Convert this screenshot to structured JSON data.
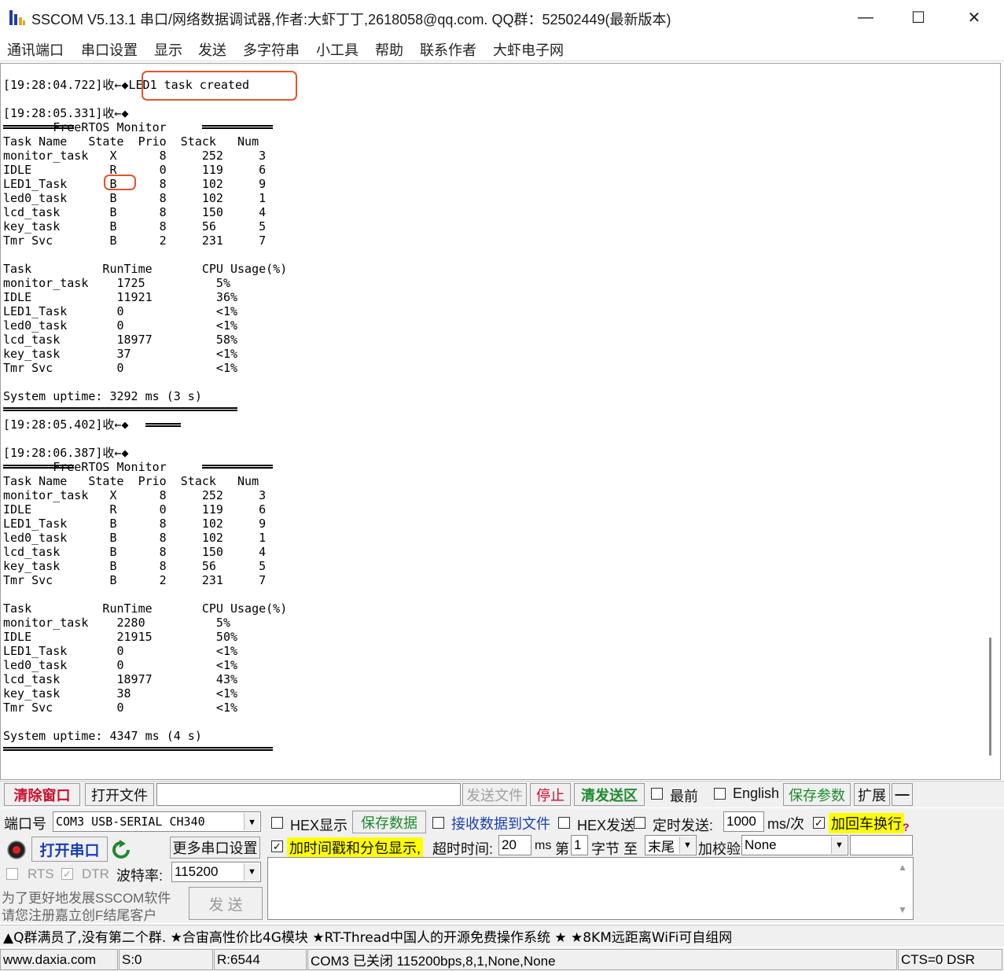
{
  "window": {
    "title": "SSCOM V5.13.1 串口/网络数据调试器,作者:大虾丁丁,2618058@qq.com. QQ群：52502449(最新版本)",
    "minimize": "—",
    "maximize": "☐",
    "close": "✕"
  },
  "menu": [
    "通讯端口",
    "串口设置",
    "显示",
    "发送",
    "多字符串",
    "小工具",
    "帮助",
    "联系作者",
    "大虾电子网"
  ],
  "receive": {
    "lines": [
      "[19:28:04.722]收←◆LED1 task created",
      "[19:28:05.331]收←◆",
      "       FreeRTOS Monitor",
      "Task Name   State  Prio  Stack   Num",
      "monitor_task   X      8     252     3",
      "IDLE           R      0     119     6",
      "LED1_Task      B      8     102     9",
      "led0_task      B      8     102     1",
      "lcd_task       B      8     150     4",
      "key_task       B      8     56      5",
      "Tmr Svc        B      2     231     7",
      "",
      "Task          RunTime       CPU Usage(%)",
      "monitor_task    1725          5%",
      "IDLE            11921         36%",
      "LED1_Task       0             <1%",
      "led0_task       0             <1%",
      "lcd_task        18977         58%",
      "key_task        37            <1%",
      "Tmr Svc         0             <1%",
      "",
      "System uptime: 3292 ms (3 s)",
      "",
      "[19:28:05.402]收←◆",
      "",
      "[19:28:06.387]收←◆",
      "       FreeRTOS Monitor",
      "Task Name   State  Prio  Stack   Num",
      "monitor_task   X      8     252     3",
      "IDLE           R      0     119     6",
      "LED1_Task      B      8     102     9",
      "led0_task      B      8     102     1",
      "lcd_task       B      8     150     4",
      "key_task       B      8     56      5",
      "Tmr Svc        B      2     231     7",
      "",
      "Task          RunTime       CPU Usage(%)",
      "monitor_task    2280          5%",
      "IDLE            21915         50%",
      "LED1_Task       0             <1%",
      "led0_task       0             <1%",
      "lcd_task        18977         43%",
      "key_task        38            <1%",
      "Tmr Svc         0             <1%",
      "",
      "System uptime: 4347 ms (4 s)"
    ]
  },
  "toolbar": {
    "clear_window": "清除窗口",
    "open_file": "打开文件",
    "file_path": "",
    "send_file": "发送文件",
    "stop": "停止",
    "clear_send": "清发送区",
    "topmost": "最前",
    "english": "English",
    "save_params": "保存参数",
    "expand": "扩展",
    "collapse": "—"
  },
  "port": {
    "label": "端口号",
    "value": "COM3 USB-SERIAL CH340",
    "open_button": "打开串口",
    "more_settings": "更多串口设置",
    "rts": "RTS",
    "dtr": "DTR",
    "baud_label": "波特率:",
    "baud_value": "115200",
    "promo_line1": "为了更好地发展SSCOM软件",
    "promo_line2": "请您注册嘉立创F结尾客户",
    "send_button": "发  送"
  },
  "options": {
    "hex_display": "HEX显示",
    "save_data": "保存数据",
    "recv_to_file": "接收数据到文件",
    "hex_send": "HEX发送",
    "timed_send": "定时发送:",
    "interval_value": "1000",
    "interval_unit": "ms/次",
    "add_crlf": "加回车换行",
    "add_timestamp": "加时间戳和分包显示,",
    "timeout_label": "超时时间:",
    "timeout_value": "20",
    "timeout_unit": "ms",
    "byte_prefix": "第",
    "byte_value": "1",
    "byte_suffix": "字节 至",
    "end_value": "末尾",
    "checksum_label": "加校验",
    "checksum_value": "None",
    "help": "?"
  },
  "ticker": "▲Q群满员了,没有第二个群. ★合宙高性价比4G模块 ★RT-Thread中国人的开源免费操作系统 ★ ★8KM远距离WiFi可自组网",
  "status": {
    "site": "www.daxia.com",
    "sent": "S:0",
    "received": "R:6544",
    "port_state": "COM3 已关闭  115200bps,8,1,None,None",
    "lines": "CTS=0 DSR"
  },
  "colors": {
    "highlight_box": "#e0552f",
    "clear_window_text": "#c8102e",
    "green_text": "#1f8a2e",
    "blue_text": "#1a3fb0",
    "yellow_highlight": "#ffff00"
  }
}
